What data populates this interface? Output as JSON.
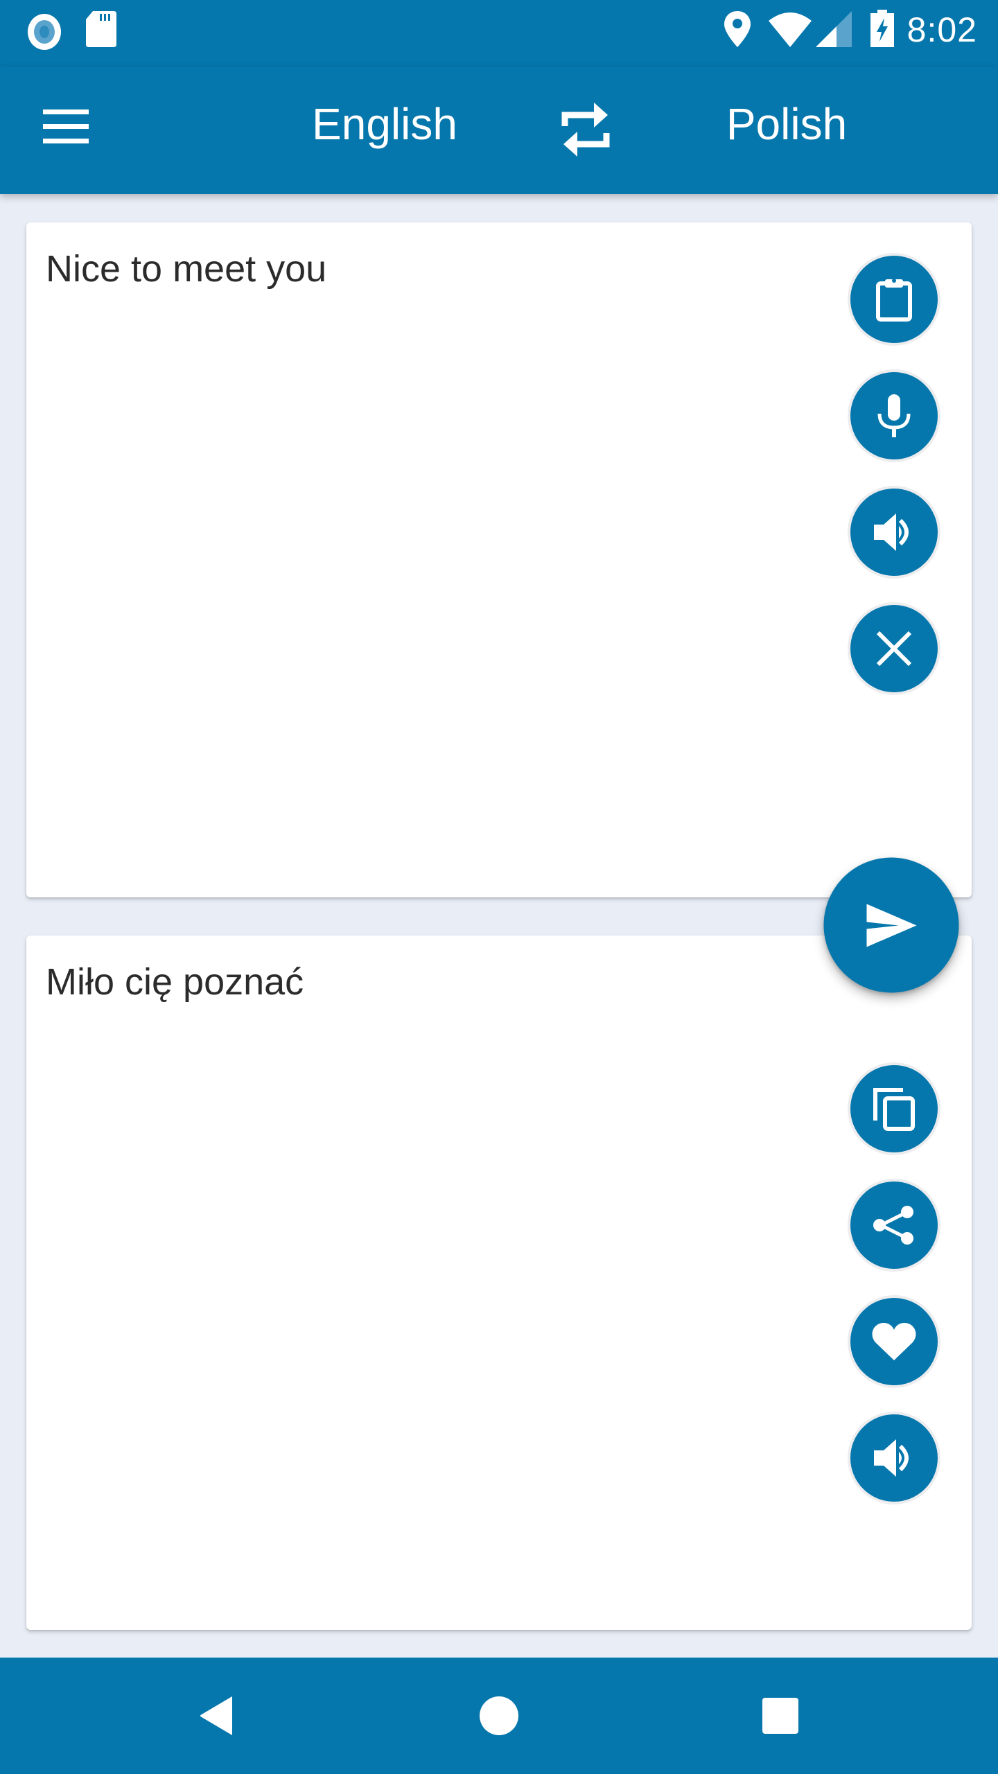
{
  "status_bar": {
    "time": "8:02",
    "left_icons": [
      "sync-circle-icon",
      "sd-card-icon"
    ],
    "right_icons": [
      "location-icon",
      "wifi-icon",
      "signal-icon",
      "battery-charging-icon"
    ]
  },
  "app_bar": {
    "menu_icon": "menu-icon",
    "source_language": "English",
    "swap_icon": "swap-icon",
    "target_language": "Polish"
  },
  "source_card": {
    "text": "Nice to meet you",
    "actions": [
      {
        "name": "paste",
        "icon": "clipboard-icon"
      },
      {
        "name": "voice-input",
        "icon": "microphone-icon"
      },
      {
        "name": "speak-source",
        "icon": "speaker-icon"
      },
      {
        "name": "clear",
        "icon": "close-icon"
      }
    ]
  },
  "translate_button": {
    "icon": "send-icon"
  },
  "target_card": {
    "text": "Miło cię poznać",
    "actions": [
      {
        "name": "copy",
        "icon": "copy-icon"
      },
      {
        "name": "share",
        "icon": "share-icon"
      },
      {
        "name": "favorite",
        "icon": "heart-icon"
      },
      {
        "name": "speak-translation",
        "icon": "speaker-icon"
      }
    ]
  },
  "nav_bar": {
    "buttons": [
      "back",
      "home",
      "recents"
    ]
  },
  "colors": {
    "primary": "#0677AC",
    "background": "#E8EDF6",
    "card": "#FFFFFF",
    "text": "#2B2B2B"
  }
}
